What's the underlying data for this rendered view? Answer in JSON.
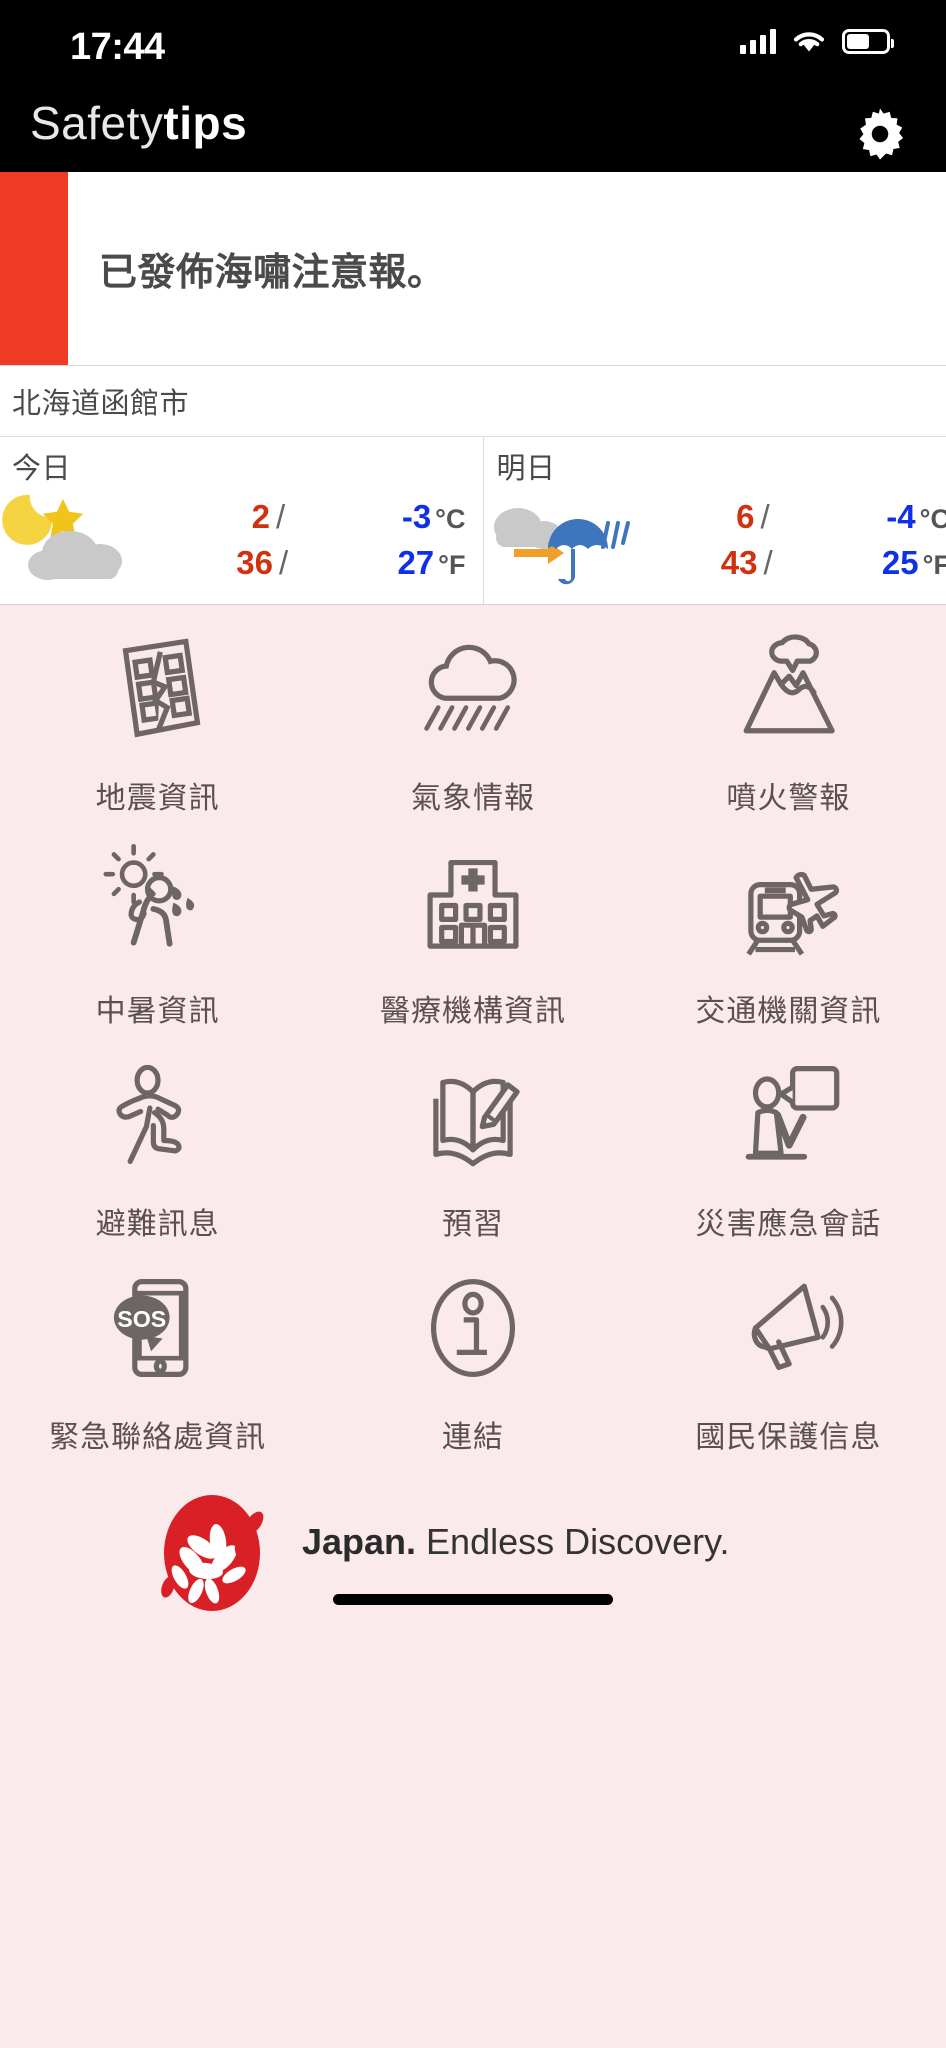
{
  "status_bar": {
    "time": "17:44",
    "icons": {
      "cellular": "cellular-signal-icon",
      "wifi": "wifi-icon",
      "battery": "battery-icon"
    }
  },
  "app_bar": {
    "brand_light": "Safety",
    "brand_bold": "tips",
    "settings_icon": "gear-icon"
  },
  "alert": {
    "message": "已發佈海嘯注意報。",
    "stripe_color": "#ef3b24"
  },
  "weather": {
    "location": "北海道函館市",
    "days": [
      {
        "label": "今日",
        "icon": "moon-star-cloud-icon",
        "celsius": {
          "high": "2",
          "low": "-3",
          "unit": "°C"
        },
        "fahrenheit": {
          "high": "36",
          "low": "27",
          "unit": "°F"
        },
        "separator": "/"
      },
      {
        "label": "明日",
        "icon": "cloud-to-rain-umbrella-icon",
        "celsius": {
          "high": "6",
          "low": "-4",
          "unit": "°C"
        },
        "fahrenheit": {
          "high": "43",
          "low": "25",
          "unit": "°F"
        },
        "separator": "/"
      }
    ],
    "colors": {
      "high": "#d0320f",
      "low": "#1030e8",
      "unit": "#555555"
    }
  },
  "menu": {
    "tiles": [
      {
        "label": "地震資訊",
        "icon": "cracked-building-icon"
      },
      {
        "label": "氣象情報",
        "icon": "rain-cloud-icon"
      },
      {
        "label": "噴火警報",
        "icon": "volcano-eruption-icon"
      },
      {
        "label": "中暑資訊",
        "icon": "heatstroke-sun-person-icon"
      },
      {
        "label": "醫療機構資訊",
        "icon": "hospital-icon"
      },
      {
        "label": "交通機關資訊",
        "icon": "train-airplane-icon"
      },
      {
        "label": "避難訊息",
        "icon": "running-person-icon"
      },
      {
        "label": "預習",
        "icon": "open-book-pencil-icon"
      },
      {
        "label": "災害應急會話",
        "icon": "person-speech-bubble-icon"
      },
      {
        "label": "緊急聯絡處資訊",
        "icon": "sos-phone-icon"
      },
      {
        "label": "連結",
        "icon": "info-circle-icon"
      },
      {
        "label": "國民保護信息",
        "icon": "megaphone-icon"
      }
    ]
  },
  "footer": {
    "logo": "japan-sakura-logo",
    "tagline_bold": "Japan.",
    "tagline_rest": " Endless Discovery.",
    "logo_color": "#d92027"
  },
  "theme": {
    "page_background": "#fbeaec",
    "icon_stroke": "#6e6565",
    "label_color": "#5a5050"
  }
}
